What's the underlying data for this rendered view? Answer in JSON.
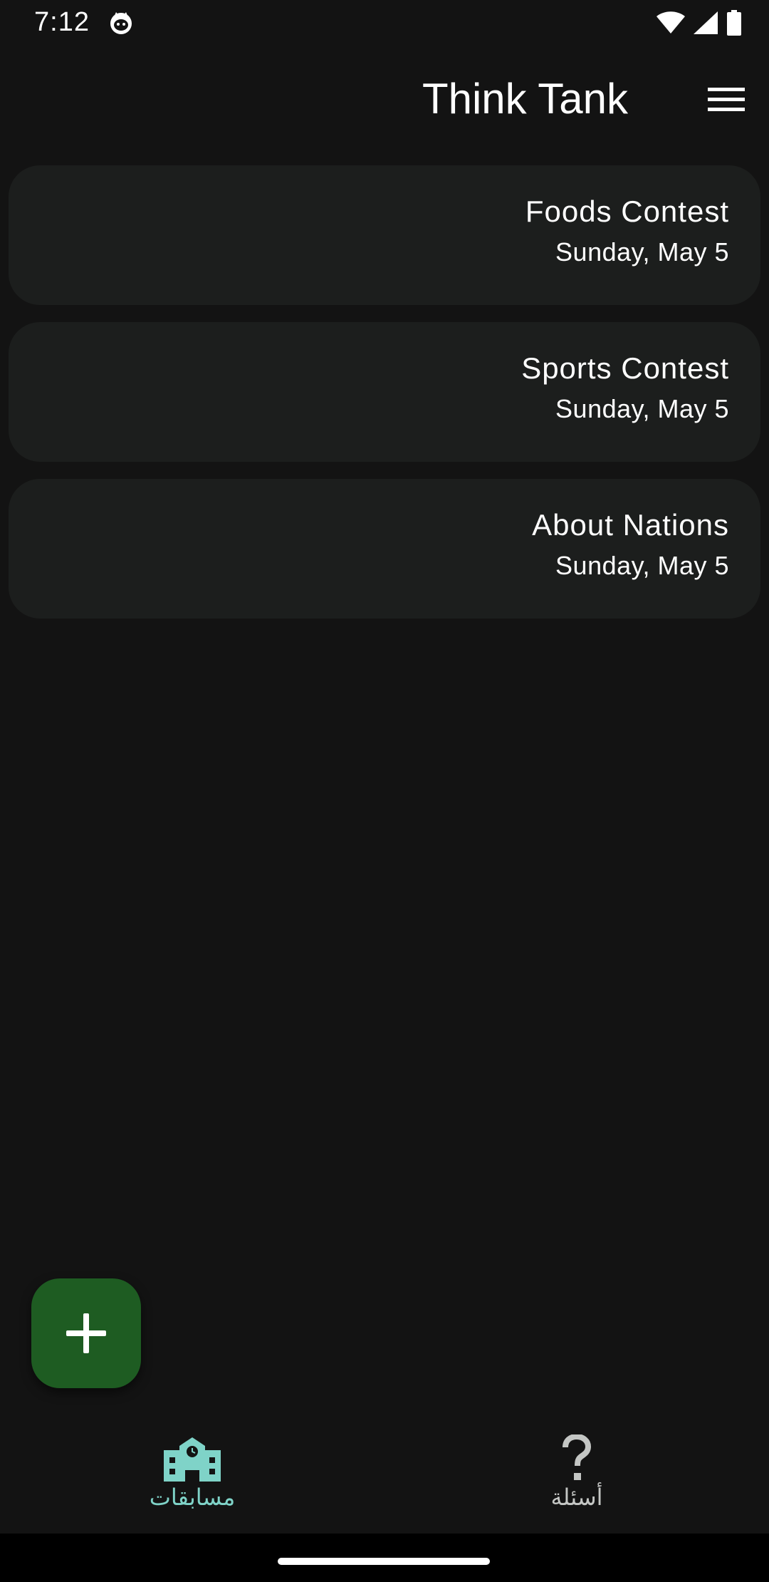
{
  "status_bar": {
    "time": "7:12",
    "icons": [
      "cat-icon",
      "wifi-icon",
      "signal-icon",
      "battery-icon"
    ]
  },
  "app_bar": {
    "title": "Think Tank",
    "menu_icon": "hamburger-menu-icon"
  },
  "contests": [
    {
      "name": "Foods Contest",
      "date": "Sunday, May 5"
    },
    {
      "name": "Sports Contest",
      "date": "Sunday, May 5"
    },
    {
      "name": "About Nations",
      "date": "Sunday, May 5"
    }
  ],
  "fab": {
    "icon": "plus-icon"
  },
  "bottom_nav": {
    "items": [
      {
        "label": "مسابقات",
        "icon": "school-icon",
        "active": true
      },
      {
        "label": "أسئلة",
        "icon": "question-mark-icon",
        "active": false
      }
    ]
  },
  "colors": {
    "background": "#131313",
    "card": "#1c1e1d",
    "fab": "#1e5c22",
    "active_nav": "#7fd3c8",
    "inactive_nav": "#c4c6c4"
  }
}
